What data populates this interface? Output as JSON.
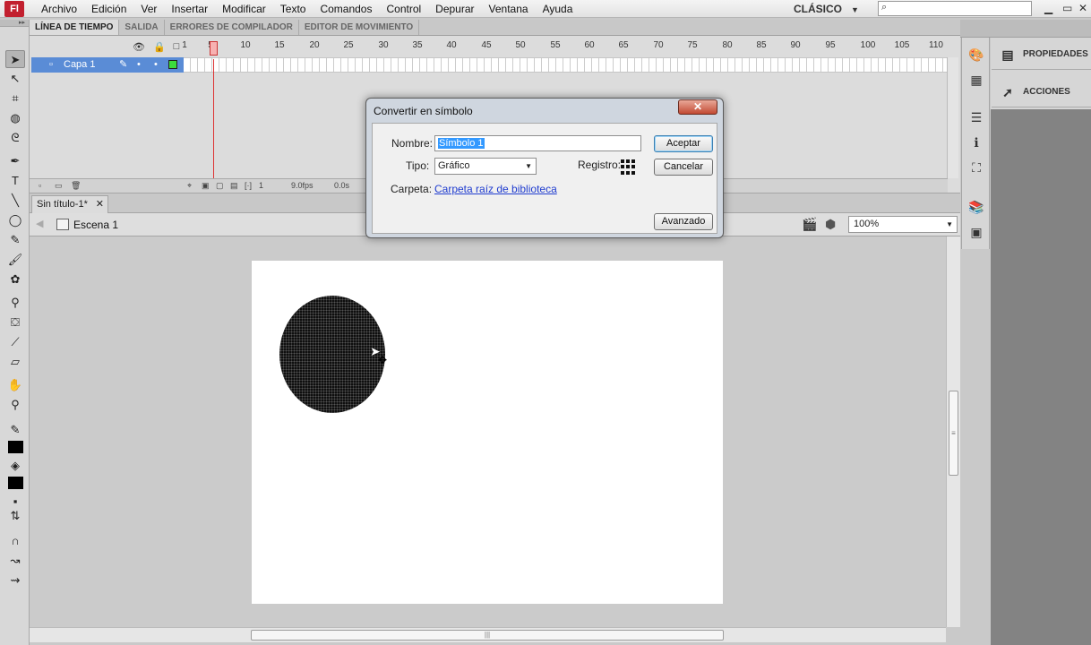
{
  "app": {
    "logo_text": "Fl",
    "menu": [
      "Archivo",
      "Edición",
      "Ver",
      "Insertar",
      "Modificar",
      "Texto",
      "Comandos",
      "Control",
      "Depurar",
      "Ventana",
      "Ayuda"
    ],
    "workspace": "CLÁSICO",
    "search_placeholder": ""
  },
  "timeline": {
    "tabs": [
      "LÍNEA DE TIEMPO",
      "SALIDA",
      "ERRORES DE COMPILADOR",
      "EDITOR DE MOVIMIENTO"
    ],
    "ruler": [
      "1",
      "5",
      "10",
      "15",
      "20",
      "25",
      "30",
      "35",
      "40",
      "45",
      "50",
      "55",
      "60",
      "65",
      "70",
      "75",
      "80",
      "85",
      "90",
      "95",
      "100",
      "105",
      "110"
    ],
    "layer_name": "Capa 1",
    "footer": {
      "frame": "1",
      "fps": "9.0fps",
      "time": "0.0s"
    }
  },
  "document": {
    "tab_label": "Sin título-1*",
    "scene": "Escena 1",
    "zoom": "100%"
  },
  "right_panel": {
    "items": [
      "PROPIEDADES",
      "ACCIONES"
    ]
  },
  "dialog": {
    "title": "Convertir en símbolo",
    "name_label": "Nombre:",
    "name_value": "Símbolo 1",
    "type_label": "Tipo:",
    "type_value": "Gráfico",
    "registro_label": "Registro:",
    "folder_label": "Carpeta:",
    "folder_link": "Carpeta raíz de biblioteca",
    "accept": "Aceptar",
    "cancel": "Cancelar",
    "advanced": "Avanzado",
    "close_glyph": "✕"
  },
  "colors": {
    "accent_layer": "#5a8cd6",
    "close_red": "#c24a33",
    "link": "#1f3ccf"
  }
}
